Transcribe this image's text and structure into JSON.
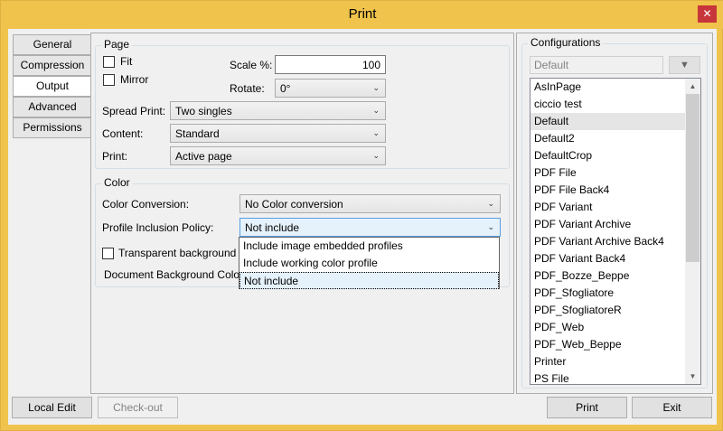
{
  "window": {
    "title": "Print",
    "close_label": "✕"
  },
  "tabs": [
    {
      "label": "General"
    },
    {
      "label": "Compression"
    },
    {
      "label": "Output"
    },
    {
      "label": "Advanced"
    },
    {
      "label": "Permissions"
    }
  ],
  "page_group": {
    "legend": "Page",
    "fit_label": "Fit",
    "mirror_label": "Mirror",
    "scale_label": "Scale %:",
    "scale_value": "100",
    "rotate_label": "Rotate:",
    "rotate_value": "0°",
    "spread_label": "Spread Print:",
    "spread_value": "Two singles",
    "content_label": "Content:",
    "content_value": "Standard",
    "print_label": "Print:",
    "print_value": "Active page"
  },
  "color_group": {
    "legend": "Color",
    "conversion_label": "Color Conversion:",
    "conversion_value": "No Color conversion",
    "policy_label": "Profile Inclusion Policy:",
    "policy_value": "Not include",
    "transparent_label": "Transparent background",
    "doc_bg_label": "Document Background Colo",
    "policy_options": [
      "Include image embedded profiles",
      "Include working color profile",
      "Not include"
    ]
  },
  "configurations": {
    "legend": "Configurations",
    "default_value": "Default",
    "items": [
      "AsInPage",
      "ciccio test",
      "Default",
      "Default2",
      "DefaultCrop",
      "PDF File",
      "PDF File Back4",
      "PDF Variant",
      "PDF Variant Archive",
      "PDF Variant Archive Back4",
      "PDF Variant Back4",
      "PDF_Bozze_Beppe",
      "PDF_Sfogliatore",
      "PDF_SfogliatoreR",
      "PDF_Web",
      "PDF_Web_Beppe",
      "Printer",
      "PS File"
    ],
    "selected": "Default"
  },
  "footer": {
    "local_edit": "Local Edit",
    "check_out": "Check-out",
    "print": "Print",
    "exit": "Exit"
  },
  "colors": {
    "titlebar": "#f0c34c",
    "close": "#c7363a",
    "focus_blue": "#e5f1fb"
  }
}
